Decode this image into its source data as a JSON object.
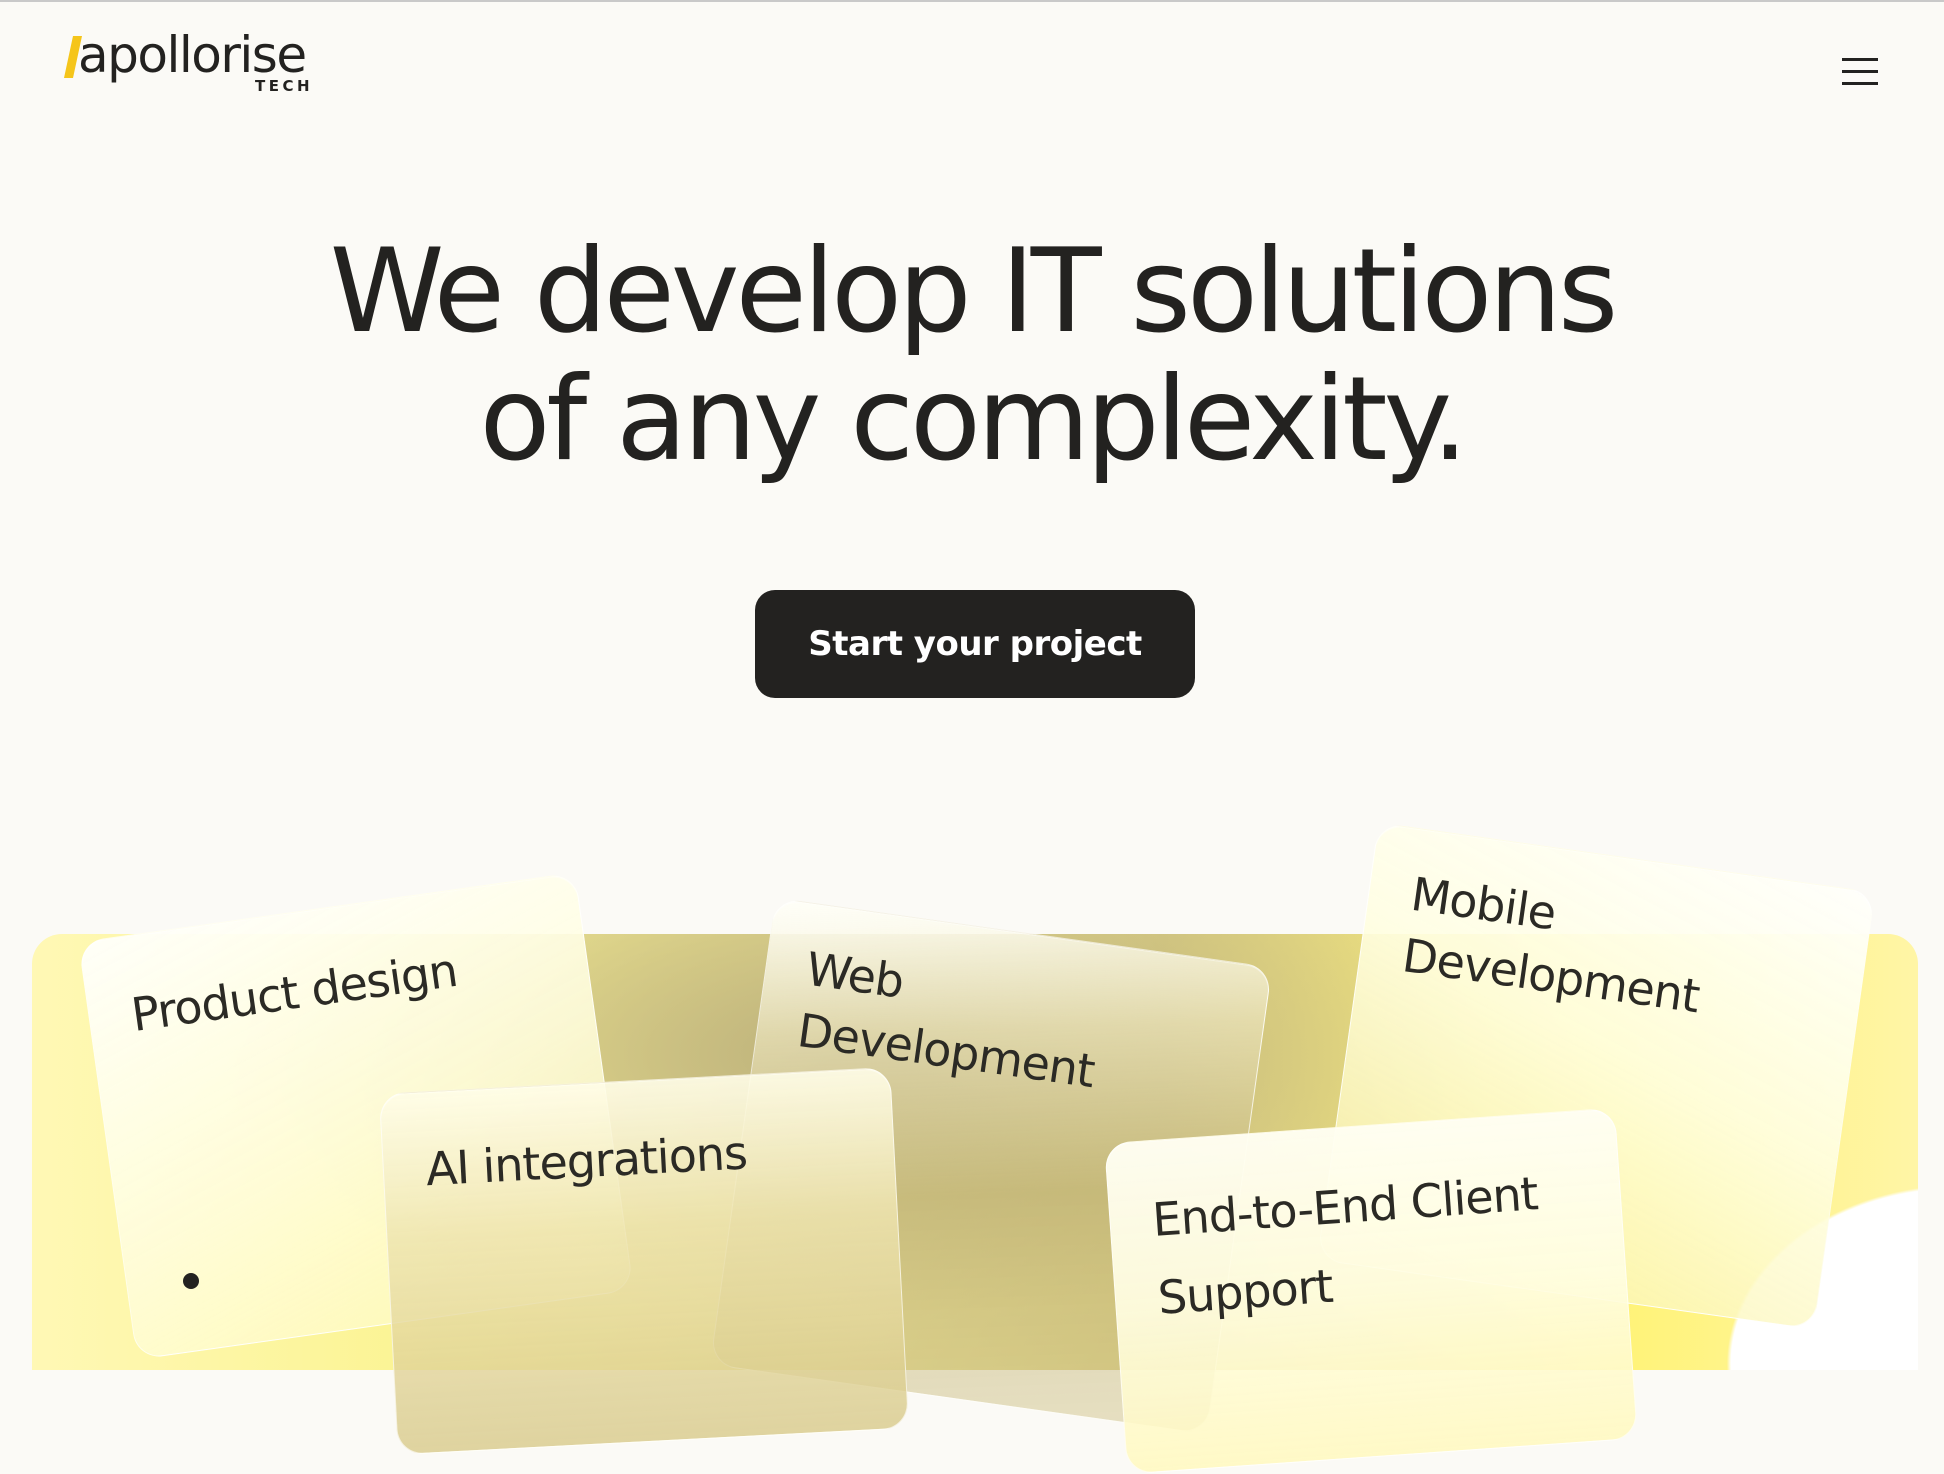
{
  "header": {
    "logo": {
      "name": "apollorise",
      "sub": "TECH",
      "accent_color": "#f5c51a"
    },
    "menu_icon": "hamburger-menu-icon"
  },
  "hero": {
    "headline_line1": "We develop IT solutions",
    "headline_line2": "of any complexity.",
    "cta_label": "Start your project"
  },
  "services": {
    "product_design": "Product design",
    "web_development": [
      "Web",
      "Development"
    ],
    "mobile_development": [
      "Mobile",
      "Development"
    ],
    "ai_integrations": "AI integrations",
    "support": [
      "End-to-End Client",
      "Support"
    ]
  },
  "colors": {
    "text": "#232220",
    "background": "#fbfaf6",
    "button": "#232220",
    "panel_yellow": "#fbf494"
  }
}
